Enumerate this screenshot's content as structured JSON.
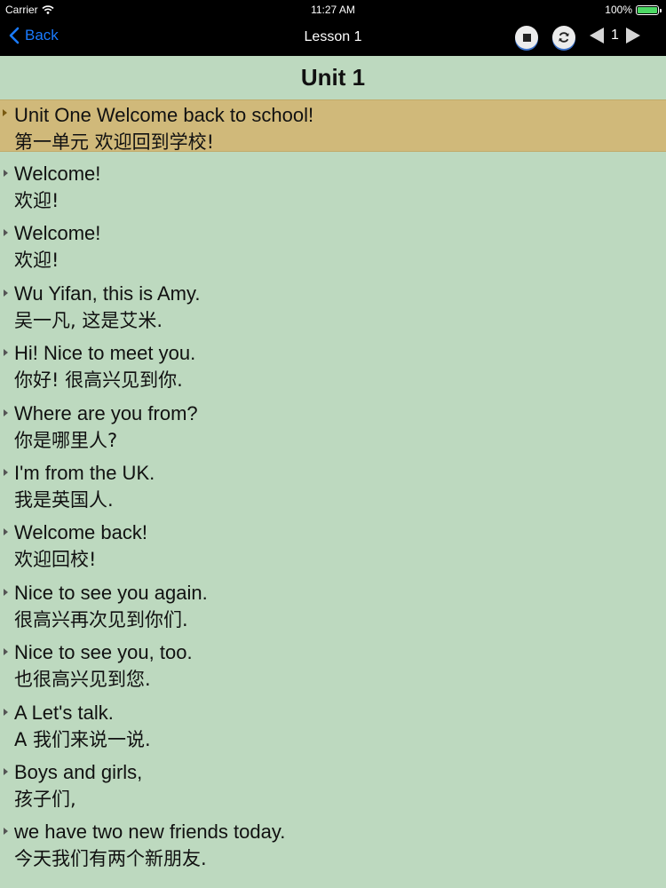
{
  "status_bar": {
    "carrier": "Carrier",
    "time": "11:27 AM",
    "battery": "100%",
    "battery_level": 1.0,
    "battery_color": "#4cd964"
  },
  "navbar": {
    "back_label": "Back",
    "title": "Lesson 1",
    "page_number": "1",
    "accent": "#1a7bff"
  },
  "unit_title": "Unit 1",
  "active_row_color": "#d0b97a",
  "lines": [
    {
      "en": "Unit One Welcome back to school!",
      "zh": "第一单元 欢迎回到学校!",
      "active": true
    },
    {
      "en": "Welcome!",
      "zh": "欢迎!"
    },
    {
      "en": "Welcome!",
      "zh": "欢迎!"
    },
    {
      "en": "Wu Yifan, this is Amy.",
      "zh": "吴一凡, 这是艾米."
    },
    {
      "en": "Hi! Nice to meet you.",
      "zh": "你好! 很高兴见到你."
    },
    {
      "en": "Where are you from?",
      "zh": "你是哪里人?"
    },
    {
      "en": "I'm from the UK.",
      "zh": "我是英国人."
    },
    {
      "en": "Welcome back!",
      "zh": "欢迎回校!"
    },
    {
      "en": "Nice to see you again.",
      "zh": "很高兴再次见到你们."
    },
    {
      "en": "Nice to see you, too.",
      "zh": "也很高兴见到您."
    },
    {
      "en": "A Let's talk.",
      "zh": "A 我们来说一说."
    },
    {
      "en": "Boys and girls,",
      "zh": "孩子们,"
    },
    {
      "en": "we have two new friends today.",
      "zh": "今天我们有两个新朋友."
    }
  ]
}
